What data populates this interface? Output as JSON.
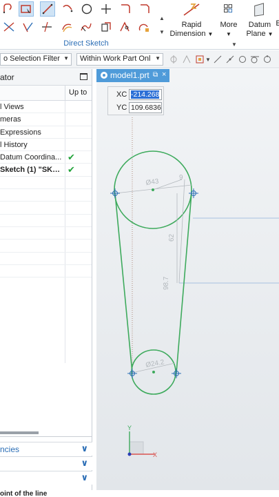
{
  "ribbon": {
    "group_label": "Direct Sketch",
    "rapid_dimension": {
      "line1": "Rapid",
      "line2": "Dimension"
    },
    "more": "More",
    "datum_plane": {
      "line1": "Datum",
      "line2": "Plane"
    },
    "cut_letter": "E"
  },
  "filter_bar": {
    "selection_filter": "o Selection Filter",
    "scope": "Within Work Part Onl"
  },
  "navigator": {
    "title": "ator",
    "column_up_to": "Up to",
    "rows": [
      {
        "label": "l Views",
        "check": ""
      },
      {
        "label": "meras",
        "check": ""
      },
      {
        "label": "Expressions",
        "check": ""
      },
      {
        "label": "l History",
        "check": ""
      },
      {
        "label": "Datum Coordina...",
        "check": "✔"
      },
      {
        "label": "Sketch (1) \"SKE...",
        "check": "✔"
      }
    ],
    "sections": [
      {
        "label": "ncies"
      },
      {
        "label": ""
      },
      {
        "label": ""
      }
    ]
  },
  "status_text": "oint of the line",
  "graphics": {
    "tab_name": "model1.prt",
    "pin": "⧉",
    "close": "×",
    "xc_label": "XC",
    "xc_value": "-214.268",
    "yc_label": "YC",
    "yc_value": "109.6836",
    "dims": {
      "top_diameter": "Ø43",
      "small_dim": "9",
      "vertical_dim": "62",
      "center_distance": "98.7",
      "bottom_diameter": "Ø24.2"
    },
    "triad_x": "X",
    "triad_y": "Y"
  },
  "colors": {
    "accent": "#2a6db5",
    "tab": "#4f9bd9",
    "sketch_curve": "#3daa5c",
    "check": "#22a33a",
    "constraint": "#2a6db5"
  }
}
